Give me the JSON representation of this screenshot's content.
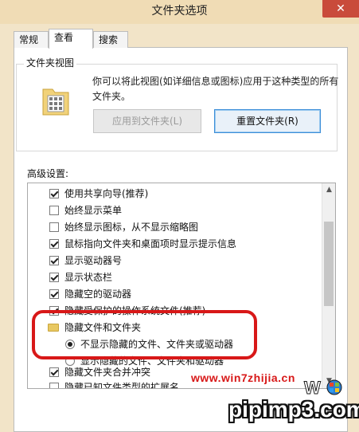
{
  "window": {
    "title": "文件夹选项",
    "close_label": "✕"
  },
  "tabs": [
    {
      "label": "常规",
      "active": false
    },
    {
      "label": "查看",
      "active": true
    },
    {
      "label": "搜索",
      "active": false
    }
  ],
  "folder_views": {
    "title": "文件夹视图",
    "description": "你可以将此视图(如详细信息或图标)应用于这种类型的所有文件夹。",
    "apply_button": "应用到文件夹(L)",
    "reset_button": "重置文件夹(R)"
  },
  "advanced": {
    "label": "高级设置:",
    "items": [
      {
        "type": "checkbox",
        "checked": true,
        "label": "使用共享向导(推荐)"
      },
      {
        "type": "checkbox",
        "checked": false,
        "label": "始终显示菜单"
      },
      {
        "type": "checkbox",
        "checked": false,
        "label": "始终显示图标，从不显示缩略图"
      },
      {
        "type": "checkbox",
        "checked": true,
        "label": "鼠标指向文件夹和桌面项时显示提示信息"
      },
      {
        "type": "checkbox",
        "checked": true,
        "label": "显示驱动器号"
      },
      {
        "type": "checkbox",
        "checked": true,
        "label": "显示状态栏"
      },
      {
        "type": "checkbox",
        "checked": true,
        "label": "隐藏空的驱动器"
      },
      {
        "type": "checkbox",
        "checked": true,
        "label": "隐藏受保护的操作系统文件(推荐)"
      },
      {
        "type": "folder",
        "label": "隐藏文件和文件夹"
      },
      {
        "type": "radio",
        "selected": true,
        "label": "不显示隐藏的文件、文件夹或驱动器"
      },
      {
        "type": "radio",
        "selected": false,
        "label": "显示隐藏的文件、文件夹和驱动器"
      },
      {
        "type": "checkbox",
        "checked": true,
        "label": "隐藏文件夹合并冲突"
      },
      {
        "type": "checkbox",
        "checked": false,
        "label": "隐藏已知文件类型的扩展名"
      }
    ]
  },
  "watermark": {
    "site": "www.win7zhijia.cn",
    "brand": "pipimp3.com"
  },
  "colors": {
    "highlight": "#d81818",
    "titlebar": "#f0dcb5",
    "close": "#c94b3b"
  }
}
